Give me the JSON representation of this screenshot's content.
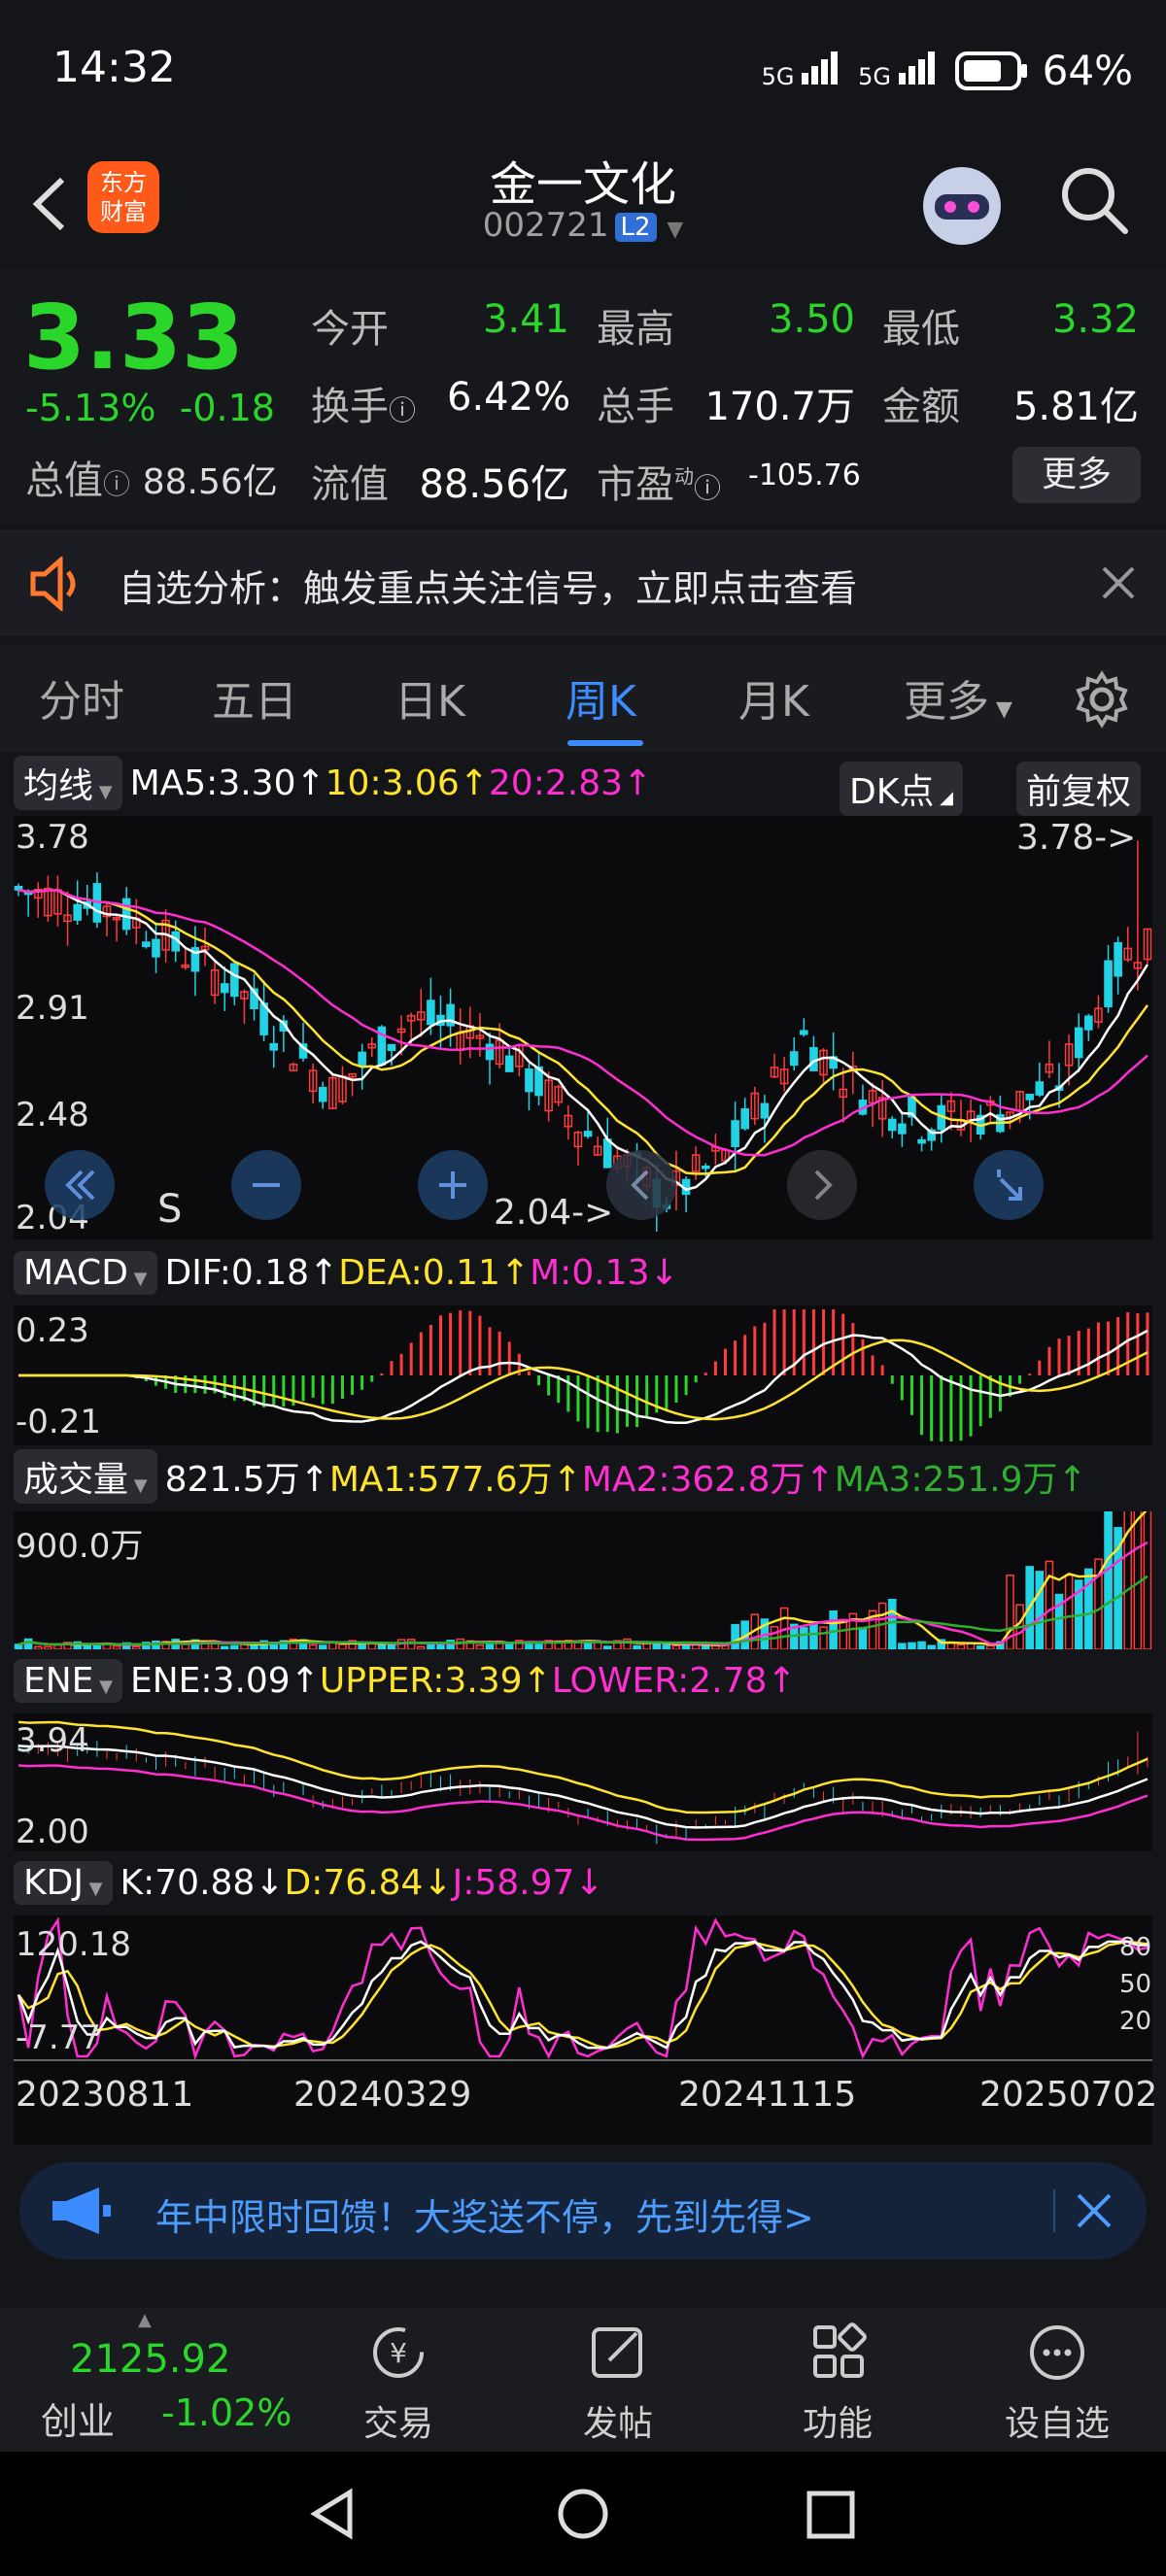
{
  "status": {
    "time": "14:32",
    "battery": "64%",
    "net1": "5G",
    "net2": "5G"
  },
  "header": {
    "title": "金一文化",
    "code": "002721",
    "badge": "L2",
    "logo_line1": "东方",
    "logo_line2": "财富"
  },
  "quote": {
    "price": "3.33",
    "change_pct": "-5.13%",
    "change": "-0.18",
    "mv_label": "总值",
    "mv_value": "88.56亿",
    "open_label": "今开",
    "open": "3.41",
    "high_label": "最高",
    "high": "3.50",
    "low_label": "最低",
    "low": "3.32",
    "turnover_label": "换手",
    "turnover": "6.42%",
    "volume_label": "总手",
    "volume": "170.7万",
    "amount_label": "金额",
    "amount": "5.81亿",
    "float_label": "流值",
    "float": "88.56亿",
    "pe_label": "市盈",
    "pe_sup": "动",
    "pe": "-105.76",
    "more": "更多"
  },
  "notice": {
    "text": "自选分析：触发重点关注信号，立即点击查看"
  },
  "tabs": [
    "分时",
    "五日",
    "日K",
    "周K",
    "月K",
    "更多"
  ],
  "active_tab": "周K",
  "ma_row": {
    "tag": "均线",
    "ma5": "MA5:3.30↑",
    "ma10": "10:3.06↑",
    "ma20": "20:2.83↑",
    "dk": "DK点",
    "adj": "前复权"
  },
  "kline": {
    "y_labels": [
      "3.78",
      "2.91",
      "2.48",
      "2.04"
    ],
    "high_mark": "3.78->",
    "low_mark": "2.04->",
    "signal": "S"
  },
  "macd": {
    "tag": "MACD",
    "dif": "DIF:0.18↑",
    "dea": "DEA:0.11↑",
    "m": "M:0.13↓",
    "y_top": "0.23",
    "y_bottom": "-0.21"
  },
  "vol": {
    "tag": "成交量",
    "v": "821.5万↑",
    "ma1": "MA1:577.6万↑",
    "ma2": "MA2:362.8万↑",
    "ma3": "MA3:251.9万↑",
    "y_top": "900.0万"
  },
  "ene": {
    "tag": "ENE",
    "ene": "ENE:3.09↑",
    "upper": "UPPER:3.39↑",
    "lower": "LOWER:2.78↑",
    "y_top": "3.94",
    "y_bottom": "2.00"
  },
  "kdj": {
    "tag": "KDJ",
    "k": "K:70.88↓",
    "d": "D:76.84↓",
    "j": "J:58.97↓",
    "y_top": "120.18",
    "y_bottom": "-7.77",
    "r80": "80",
    "r50": "50",
    "r20": "20"
  },
  "dates": [
    "20230811",
    "20240329",
    "20241115",
    "20250702"
  ],
  "banner": {
    "text": "年中限时回馈！大奖送不停，先到先得>"
  },
  "bottom_nav": {
    "index_value": "2125.92",
    "index_name": "创业",
    "index_pct": "-1.02%",
    "items": [
      "交易",
      "发帖",
      "功能",
      "设自选"
    ]
  },
  "colors": {
    "up": "#ff3b3b",
    "down": "#2bd62b",
    "accent": "#3d8cff",
    "ma5": "#ffffff",
    "ma10": "#ffe42e",
    "ma20": "#ff2ed1"
  }
}
